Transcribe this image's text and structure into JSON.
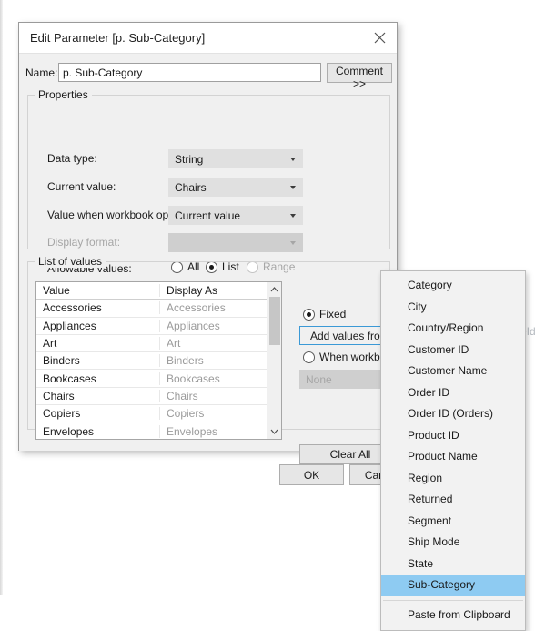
{
  "dialog": {
    "title": "Edit Parameter [p. Sub-Category]",
    "close_icon": "close-icon",
    "name_label": "Name:",
    "name_value": "p. Sub-Category",
    "name_placeholder": "Name",
    "comment_button": "Comment >>",
    "properties_legend": "Properties",
    "fields": [
      {
        "label": "Data type:",
        "value": "String",
        "disabled": false
      },
      {
        "label": "Current value:",
        "value": "Chairs",
        "disabled": false
      },
      {
        "label": "Value when workbook opens:",
        "value": "Current value",
        "disabled": false
      },
      {
        "label": "Display format:",
        "value": "",
        "disabled": true
      }
    ],
    "allowable_label": "Allowable values:",
    "allowable_options": [
      {
        "label": "All",
        "checked": false,
        "disabled": false
      },
      {
        "label": "List",
        "checked": true,
        "disabled": false
      },
      {
        "label": "Range",
        "checked": false,
        "disabled": true
      }
    ],
    "list_legend": "List of values",
    "table": {
      "columns": [
        "Value",
        "Display As"
      ],
      "rows": [
        [
          "Accessories",
          "Accessories"
        ],
        [
          "Appliances",
          "Appliances"
        ],
        [
          "Art",
          "Art"
        ],
        [
          "Binders",
          "Binders"
        ],
        [
          "Bookcases",
          "Bookcases"
        ],
        [
          "Chairs",
          "Chairs"
        ],
        [
          "Copiers",
          "Copiers"
        ],
        [
          "Envelopes",
          "Envelopes"
        ]
      ],
      "scroll_up_icon": "chevron-up-icon",
      "scroll_down_icon": "chevron-down-icon"
    },
    "fixed_option": {
      "label": "Fixed",
      "checked": true
    },
    "add_values_button": {
      "label": "Add values from",
      "arrow_icon": "chevron-right-icon"
    },
    "workbook_opens_option": {
      "label": "When workbook opens",
      "checked": false
    },
    "none_combo": {
      "value": "None",
      "disabled": true
    },
    "clear_all_button": "Clear All",
    "ok_button": "OK",
    "cancel_button": "Cancel"
  },
  "context_menu": {
    "items": [
      {
        "label": "Category",
        "selected": false,
        "separator_before": false
      },
      {
        "label": "City",
        "selected": false,
        "separator_before": false
      },
      {
        "label": "Country/Region",
        "selected": false,
        "separator_before": false
      },
      {
        "label": "Customer ID",
        "selected": false,
        "separator_before": false
      },
      {
        "label": "Customer Name",
        "selected": false,
        "separator_before": false
      },
      {
        "label": "Order ID",
        "selected": false,
        "separator_before": false
      },
      {
        "label": "Order ID (Orders)",
        "selected": false,
        "separator_before": false
      },
      {
        "label": "Product ID",
        "selected": false,
        "separator_before": false
      },
      {
        "label": "Product Name",
        "selected": false,
        "separator_before": false
      },
      {
        "label": "Region",
        "selected": false,
        "separator_before": false
      },
      {
        "label": "Returned",
        "selected": false,
        "separator_before": false
      },
      {
        "label": "Segment",
        "selected": false,
        "separator_before": false
      },
      {
        "label": "Ship Mode",
        "selected": false,
        "separator_before": false
      },
      {
        "label": "State",
        "selected": false,
        "separator_before": false
      },
      {
        "label": "Sub-Category",
        "selected": true,
        "separator_before": false
      },
      {
        "label": "Paste from Clipboard",
        "selected": false,
        "separator_before": true
      }
    ]
  },
  "background": {
    "partial_text": "eld"
  },
  "colors": {
    "accent": "#3b99d6",
    "menu_highlight": "#8ecbf2",
    "dialog_bg": "#f0f0f0",
    "combo_bg": "#e0e0e0"
  }
}
